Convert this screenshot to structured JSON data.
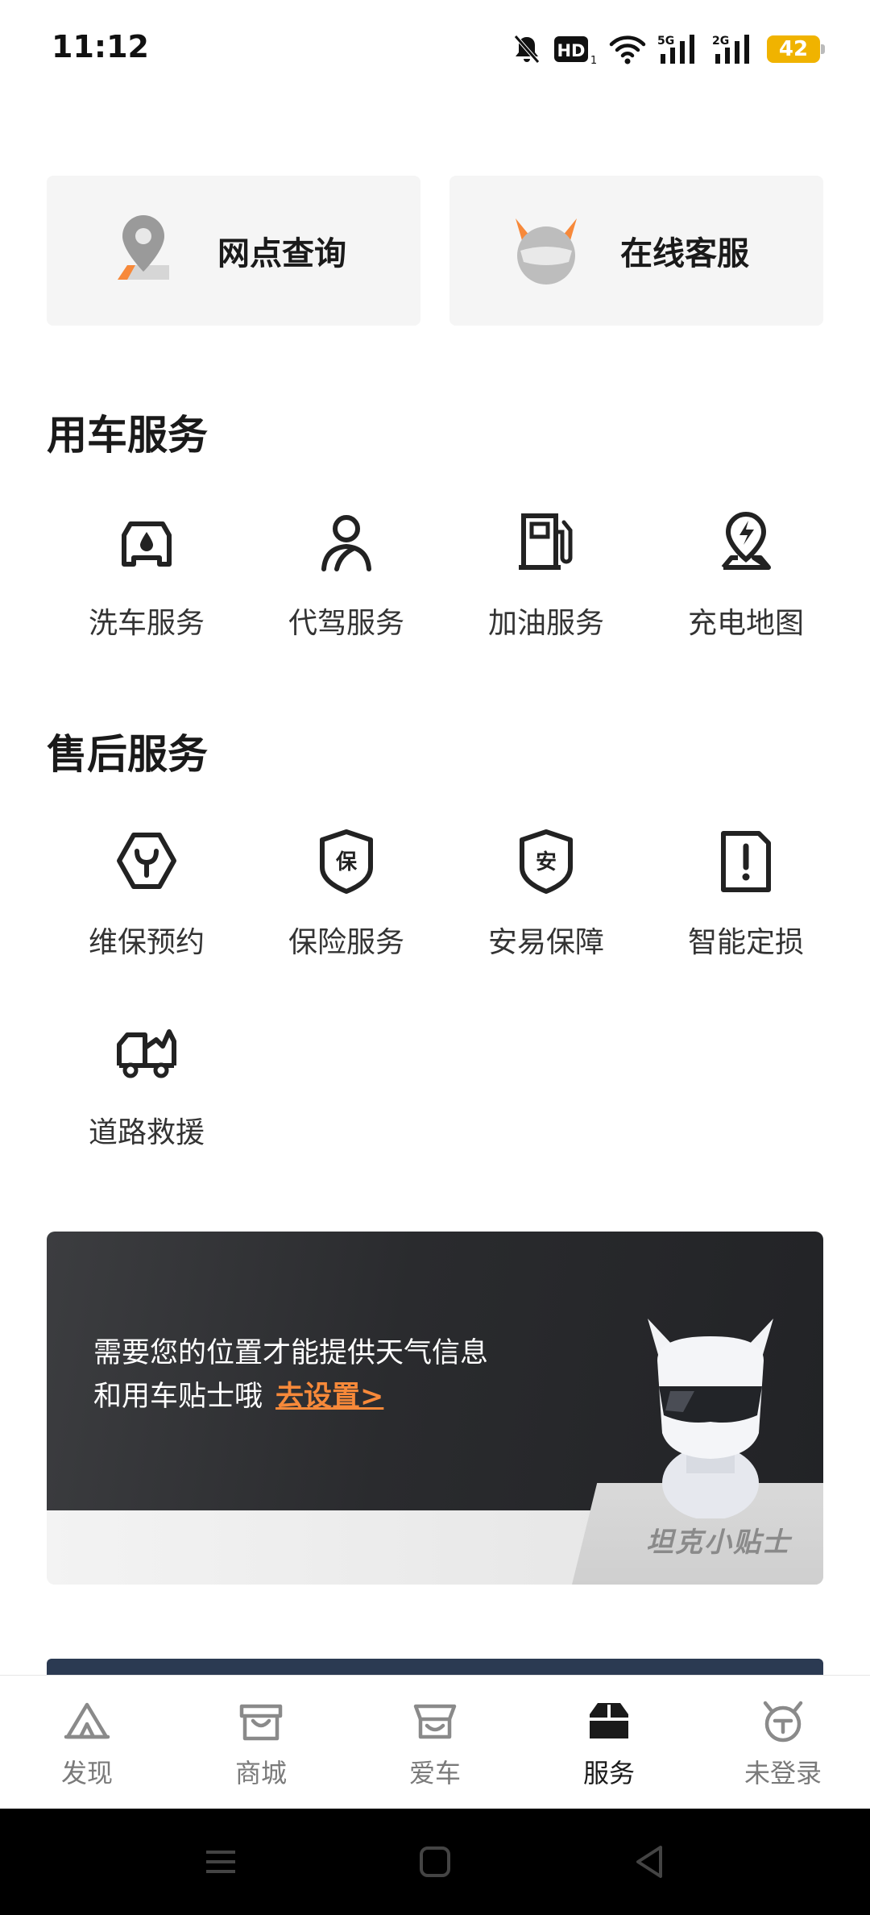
{
  "status_bar": {
    "time": "11:12",
    "network_5g": "5G",
    "network_2g": "2G",
    "hd": "HD",
    "hd_sub": "1",
    "battery": "42",
    "icons": [
      "mute-bell-icon",
      "hd-icon",
      "wifi-icon",
      "signal-5g-icon",
      "signal-2g-icon",
      "battery-icon"
    ]
  },
  "quick_actions": [
    {
      "label": "网点查询",
      "icon": "location-pin-icon"
    },
    {
      "label": "在线客服",
      "icon": "mascot-head-icon"
    }
  ],
  "car_services": {
    "title": "用车服务",
    "items": [
      {
        "label": "洗车服务",
        "icon": "car-wash-icon"
      },
      {
        "label": "代驾服务",
        "icon": "chauffeur-icon"
      },
      {
        "label": "加油服务",
        "icon": "fuel-pump-icon"
      },
      {
        "label": "充电地图",
        "icon": "charging-map-icon"
      }
    ]
  },
  "after_sales": {
    "title": "售后服务",
    "items": [
      {
        "label": "维保预约",
        "icon": "maintenance-wrench-icon"
      },
      {
        "label": "保险服务",
        "icon": "insurance-shield-icon",
        "glyph": "保"
      },
      {
        "label": "安易保障",
        "icon": "anyi-shield-icon",
        "glyph": "安"
      },
      {
        "label": "智能定损",
        "icon": "damage-assessment-icon"
      },
      {
        "label": "道路救援",
        "icon": "tow-truck-icon"
      }
    ]
  },
  "banner": {
    "line1": "需要您的位置才能提供天气信息",
    "line2": "和用车贴士哦",
    "link": "去设置>",
    "tag": "坦克小贴士"
  },
  "bottom_nav": [
    {
      "label": "发现",
      "icon": "discover-icon",
      "active": false
    },
    {
      "label": "商城",
      "icon": "mall-icon",
      "active": false
    },
    {
      "label": "爱车",
      "icon": "my-car-icon",
      "active": false
    },
    {
      "label": "服务",
      "icon": "service-icon",
      "active": true
    },
    {
      "label": "未登录",
      "icon": "profile-icon",
      "active": false
    }
  ],
  "colors": {
    "accent": "#f7893a",
    "battery": "#f0b300",
    "banner_dark": "#2a2b2e"
  }
}
